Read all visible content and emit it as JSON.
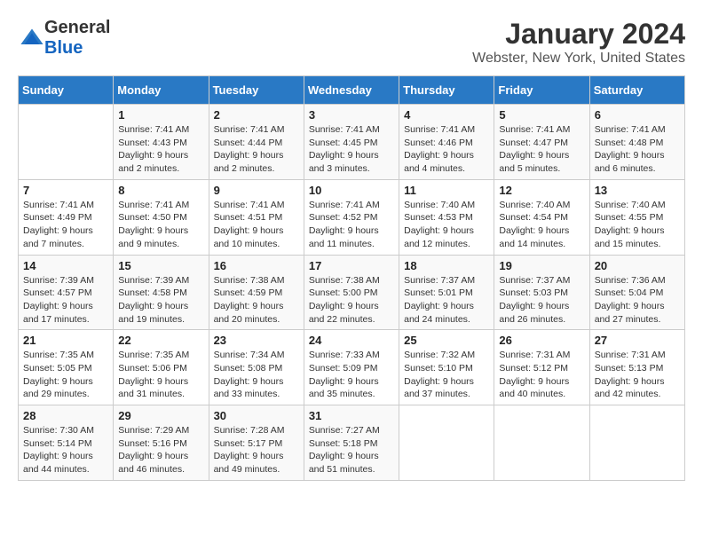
{
  "header": {
    "logo_general": "General",
    "logo_blue": "Blue",
    "title": "January 2024",
    "subtitle": "Webster, New York, United States"
  },
  "days_of_week": [
    "Sunday",
    "Monday",
    "Tuesday",
    "Wednesday",
    "Thursday",
    "Friday",
    "Saturday"
  ],
  "weeks": [
    [
      {
        "day": "",
        "sunrise": "",
        "sunset": "",
        "daylight": ""
      },
      {
        "day": "1",
        "sunrise": "Sunrise: 7:41 AM",
        "sunset": "Sunset: 4:43 PM",
        "daylight": "Daylight: 9 hours and 2 minutes."
      },
      {
        "day": "2",
        "sunrise": "Sunrise: 7:41 AM",
        "sunset": "Sunset: 4:44 PM",
        "daylight": "Daylight: 9 hours and 2 minutes."
      },
      {
        "day": "3",
        "sunrise": "Sunrise: 7:41 AM",
        "sunset": "Sunset: 4:45 PM",
        "daylight": "Daylight: 9 hours and 3 minutes."
      },
      {
        "day": "4",
        "sunrise": "Sunrise: 7:41 AM",
        "sunset": "Sunset: 4:46 PM",
        "daylight": "Daylight: 9 hours and 4 minutes."
      },
      {
        "day": "5",
        "sunrise": "Sunrise: 7:41 AM",
        "sunset": "Sunset: 4:47 PM",
        "daylight": "Daylight: 9 hours and 5 minutes."
      },
      {
        "day": "6",
        "sunrise": "Sunrise: 7:41 AM",
        "sunset": "Sunset: 4:48 PM",
        "daylight": "Daylight: 9 hours and 6 minutes."
      }
    ],
    [
      {
        "day": "7",
        "sunrise": "Sunrise: 7:41 AM",
        "sunset": "Sunset: 4:49 PM",
        "daylight": "Daylight: 9 hours and 7 minutes."
      },
      {
        "day": "8",
        "sunrise": "Sunrise: 7:41 AM",
        "sunset": "Sunset: 4:50 PM",
        "daylight": "Daylight: 9 hours and 9 minutes."
      },
      {
        "day": "9",
        "sunrise": "Sunrise: 7:41 AM",
        "sunset": "Sunset: 4:51 PM",
        "daylight": "Daylight: 9 hours and 10 minutes."
      },
      {
        "day": "10",
        "sunrise": "Sunrise: 7:41 AM",
        "sunset": "Sunset: 4:52 PM",
        "daylight": "Daylight: 9 hours and 11 minutes."
      },
      {
        "day": "11",
        "sunrise": "Sunrise: 7:40 AM",
        "sunset": "Sunset: 4:53 PM",
        "daylight": "Daylight: 9 hours and 12 minutes."
      },
      {
        "day": "12",
        "sunrise": "Sunrise: 7:40 AM",
        "sunset": "Sunset: 4:54 PM",
        "daylight": "Daylight: 9 hours and 14 minutes."
      },
      {
        "day": "13",
        "sunrise": "Sunrise: 7:40 AM",
        "sunset": "Sunset: 4:55 PM",
        "daylight": "Daylight: 9 hours and 15 minutes."
      }
    ],
    [
      {
        "day": "14",
        "sunrise": "Sunrise: 7:39 AM",
        "sunset": "Sunset: 4:57 PM",
        "daylight": "Daylight: 9 hours and 17 minutes."
      },
      {
        "day": "15",
        "sunrise": "Sunrise: 7:39 AM",
        "sunset": "Sunset: 4:58 PM",
        "daylight": "Daylight: 9 hours and 19 minutes."
      },
      {
        "day": "16",
        "sunrise": "Sunrise: 7:38 AM",
        "sunset": "Sunset: 4:59 PM",
        "daylight": "Daylight: 9 hours and 20 minutes."
      },
      {
        "day": "17",
        "sunrise": "Sunrise: 7:38 AM",
        "sunset": "Sunset: 5:00 PM",
        "daylight": "Daylight: 9 hours and 22 minutes."
      },
      {
        "day": "18",
        "sunrise": "Sunrise: 7:37 AM",
        "sunset": "Sunset: 5:01 PM",
        "daylight": "Daylight: 9 hours and 24 minutes."
      },
      {
        "day": "19",
        "sunrise": "Sunrise: 7:37 AM",
        "sunset": "Sunset: 5:03 PM",
        "daylight": "Daylight: 9 hours and 26 minutes."
      },
      {
        "day": "20",
        "sunrise": "Sunrise: 7:36 AM",
        "sunset": "Sunset: 5:04 PM",
        "daylight": "Daylight: 9 hours and 27 minutes."
      }
    ],
    [
      {
        "day": "21",
        "sunrise": "Sunrise: 7:35 AM",
        "sunset": "Sunset: 5:05 PM",
        "daylight": "Daylight: 9 hours and 29 minutes."
      },
      {
        "day": "22",
        "sunrise": "Sunrise: 7:35 AM",
        "sunset": "Sunset: 5:06 PM",
        "daylight": "Daylight: 9 hours and 31 minutes."
      },
      {
        "day": "23",
        "sunrise": "Sunrise: 7:34 AM",
        "sunset": "Sunset: 5:08 PM",
        "daylight": "Daylight: 9 hours and 33 minutes."
      },
      {
        "day": "24",
        "sunrise": "Sunrise: 7:33 AM",
        "sunset": "Sunset: 5:09 PM",
        "daylight": "Daylight: 9 hours and 35 minutes."
      },
      {
        "day": "25",
        "sunrise": "Sunrise: 7:32 AM",
        "sunset": "Sunset: 5:10 PM",
        "daylight": "Daylight: 9 hours and 37 minutes."
      },
      {
        "day": "26",
        "sunrise": "Sunrise: 7:31 AM",
        "sunset": "Sunset: 5:12 PM",
        "daylight": "Daylight: 9 hours and 40 minutes."
      },
      {
        "day": "27",
        "sunrise": "Sunrise: 7:31 AM",
        "sunset": "Sunset: 5:13 PM",
        "daylight": "Daylight: 9 hours and 42 minutes."
      }
    ],
    [
      {
        "day": "28",
        "sunrise": "Sunrise: 7:30 AM",
        "sunset": "Sunset: 5:14 PM",
        "daylight": "Daylight: 9 hours and 44 minutes."
      },
      {
        "day": "29",
        "sunrise": "Sunrise: 7:29 AM",
        "sunset": "Sunset: 5:16 PM",
        "daylight": "Daylight: 9 hours and 46 minutes."
      },
      {
        "day": "30",
        "sunrise": "Sunrise: 7:28 AM",
        "sunset": "Sunset: 5:17 PM",
        "daylight": "Daylight: 9 hours and 49 minutes."
      },
      {
        "day": "31",
        "sunrise": "Sunrise: 7:27 AM",
        "sunset": "Sunset: 5:18 PM",
        "daylight": "Daylight: 9 hours and 51 minutes."
      },
      {
        "day": "",
        "sunrise": "",
        "sunset": "",
        "daylight": ""
      },
      {
        "day": "",
        "sunrise": "",
        "sunset": "",
        "daylight": ""
      },
      {
        "day": "",
        "sunrise": "",
        "sunset": "",
        "daylight": ""
      }
    ]
  ]
}
